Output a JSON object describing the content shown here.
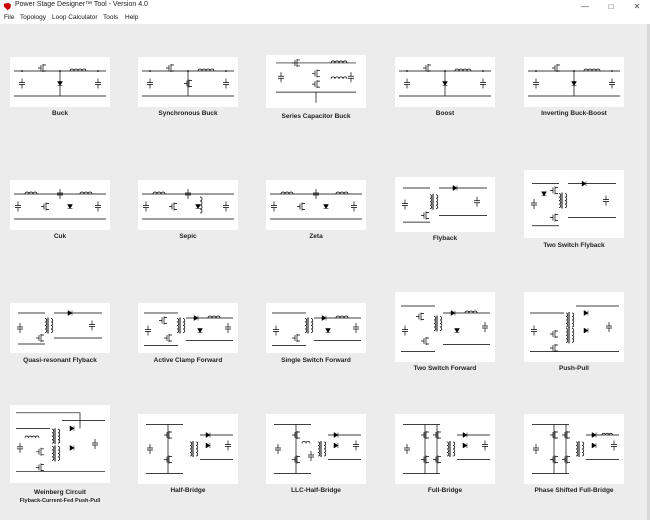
{
  "window": {
    "title": "Power Stage Designer™ Tool - Version 4.0",
    "minimize": "—",
    "maximize": "□",
    "close": "✕"
  },
  "menu": [
    "File",
    "Topology",
    "Loop Calculator",
    "Tools",
    "Help"
  ],
  "topologies": [
    {
      "label": "Buck",
      "icon": "buck-circuit-icon"
    },
    {
      "label": "Synchronous Buck",
      "icon": "synchronous-buck-circuit-icon"
    },
    {
      "label": "Series Capacitor Buck",
      "icon": "series-capacitor-buck-circuit-icon"
    },
    {
      "label": "Boost",
      "icon": "boost-circuit-icon"
    },
    {
      "label": "Inverting Buck-Boost",
      "icon": "inverting-buck-boost-circuit-icon"
    },
    {
      "label": "Cuk",
      "icon": "cuk-circuit-icon"
    },
    {
      "label": "Sepic",
      "icon": "sepic-circuit-icon"
    },
    {
      "label": "Zeta",
      "icon": "zeta-circuit-icon"
    },
    {
      "label": "Flyback",
      "icon": "flyback-circuit-icon"
    },
    {
      "label": "Two Switch Flyback",
      "icon": "two-switch-flyback-circuit-icon"
    },
    {
      "label": "Quasi-resonant Flyback",
      "icon": "quasi-resonant-flyback-circuit-icon"
    },
    {
      "label": "Active Clamp Forward",
      "icon": "active-clamp-forward-circuit-icon"
    },
    {
      "label": "Single Switch Forward",
      "icon": "single-switch-forward-circuit-icon"
    },
    {
      "label": "Two Switch Forward",
      "icon": "two-switch-forward-circuit-icon"
    },
    {
      "label": "Push-Pull",
      "icon": "push-pull-circuit-icon"
    },
    {
      "label": "Weinberg Circuit",
      "sublabel": "Flyback-Current-Fed Push-Pull",
      "icon": "weinberg-circuit-icon"
    },
    {
      "label": "Half-Bridge",
      "icon": "half-bridge-circuit-icon"
    },
    {
      "label": "LLC-Half-Bridge",
      "icon": "llc-half-bridge-circuit-icon"
    },
    {
      "label": "Full-Bridge",
      "icon": "full-bridge-circuit-icon"
    },
    {
      "label": "Phase Shifted Full-Bridge",
      "icon": "phase-shifted-full-bridge-circuit-icon"
    }
  ]
}
